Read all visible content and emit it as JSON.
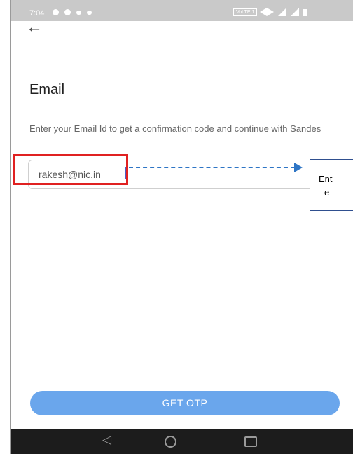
{
  "status_bar": {
    "time": "7:04",
    "network_badge": "VoLTE 1",
    "icons": [
      "chat-icon",
      "message-icon",
      "notification-icon",
      "notification-icon",
      "wifi-icon",
      "signal-icon",
      "signal-icon",
      "battery-icon"
    ]
  },
  "header": {
    "back_icon": "←",
    "title": "Email"
  },
  "form": {
    "description": "Enter your Email Id to get a confirmation code and continue with Sandes",
    "email_value": "rakesh@nic.in",
    "submit_label": "GET OTP"
  },
  "annotation": {
    "callout_line1": "Ent",
    "callout_line2": "e"
  },
  "nav": {
    "back": "◁"
  },
  "colors": {
    "highlight": "#e02121",
    "arrow": "#2e75c5",
    "button": "#6aa6ec",
    "status_bar": "#c9c9c9",
    "nav_bar": "#1c1c1c"
  }
}
